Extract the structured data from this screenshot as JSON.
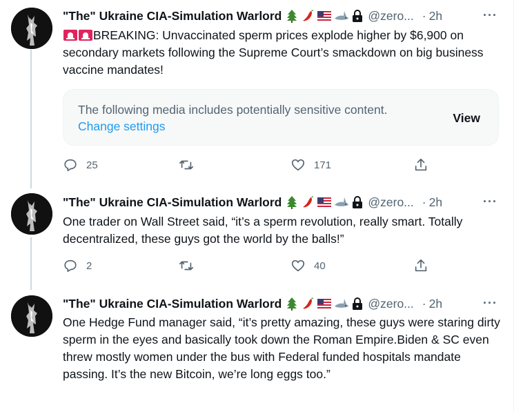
{
  "tweets": [
    {
      "author_name": "\"The\" Ukraine CIA-Simulation Warlord",
      "handle": "@zero...",
      "separator": "·",
      "time": "2h",
      "more": "···",
      "text": "BREAKING: Unvaccinated sperm prices explode higher by $6,900 on secondary markets following the Supreme Court’s smackdown on big business vaccine mandates!",
      "sensitive_notice": "The following media includes potentially sensitive content.",
      "change_settings": "Change settings",
      "view_label": "View",
      "replies": "25",
      "likes": "171"
    },
    {
      "author_name": "\"The\" Ukraine CIA-Simulation Warlord",
      "handle": "@zero...",
      "separator": "·",
      "time": "2h",
      "more": "···",
      "text": "One trader on Wall Street said, “it’s a sperm revolution, really smart. Totally decentralized, these guys got the world by the balls!”",
      "replies": "2",
      "likes": "40"
    },
    {
      "author_name": "\"The\" Ukraine CIA-Simulation Warlord",
      "handle": "@zero...",
      "separator": "·",
      "time": "2h",
      "more": "···",
      "text": "One Hedge Fund manager said, “it’s pretty amazing, these guys were staring dirty sperm in the eyes and basically took down the Roman Empire.Biden & SC even threw mostly women under the bus with Federal funded hospitals mandate passing. It’s the new Bitcoin, we’re long eggs too.”"
    }
  ],
  "name_emojis": [
    "tree-icon",
    "chili-pepper-icon",
    "us-flag-icon",
    "shark-icon",
    "lock-icon"
  ],
  "colors": {
    "link": "#1d9bf0",
    "secondary_text": "#536471",
    "primary_text": "#0f1419",
    "siren_red": "#e0245e"
  }
}
